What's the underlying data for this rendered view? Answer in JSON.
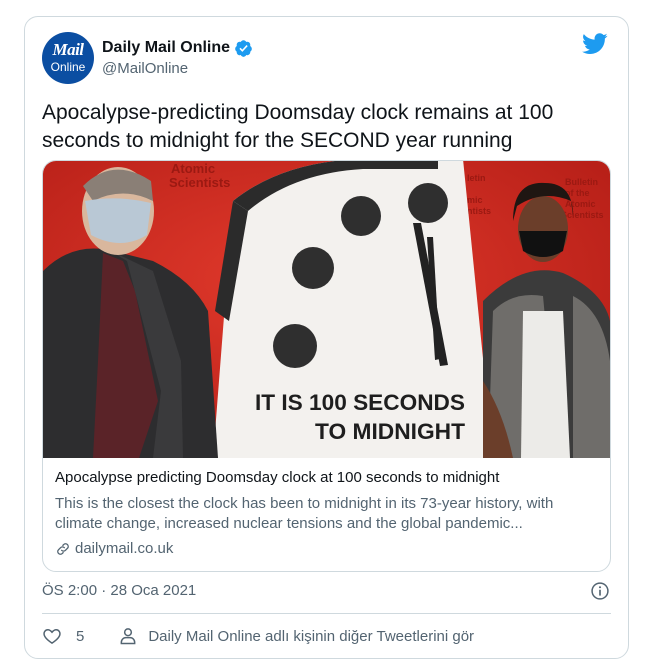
{
  "account": {
    "name": "Daily Mail Online",
    "handle": "@MailOnline",
    "avatar_line1": "Mail",
    "avatar_line2": "Online"
  },
  "tweet": {
    "text": "Apocalypse-predicting Doomsday clock remains at 100 seconds to midnight for the SECOND year running"
  },
  "link_card": {
    "title": "Apocalypse predicting Doomsday clock at 100 seconds to midnight",
    "description": "This is the closest the clock has been to midnight in its 73-year history, with climate change, increased nuclear tensions and the global pandemic...",
    "domain": "dailymail.co.uk",
    "image": {
      "sign_line1": "IT IS 100 SECONDS",
      "sign_line2": "TO MIDNIGHT",
      "banner_left": "Atomic Scientists",
      "banner_right": "Bulletin of the Atomic Scientists"
    }
  },
  "meta": {
    "timestamp": "ÖS 2:00 · 28 Oca 2021"
  },
  "footer": {
    "likes": "5",
    "more_tweets": "Daily Mail Online adlı kişinin diğer Tweetlerini gör"
  },
  "colors": {
    "twitter_blue": "#1d9bf0",
    "like_red": "#e0245e",
    "mail_blue": "#0b4ea2",
    "banner_red": "#d42a23"
  },
  "icons": [
    "twitter-bird-icon",
    "verified-badge-icon",
    "link-icon",
    "info-icon",
    "heart-icon",
    "person-icon"
  ]
}
